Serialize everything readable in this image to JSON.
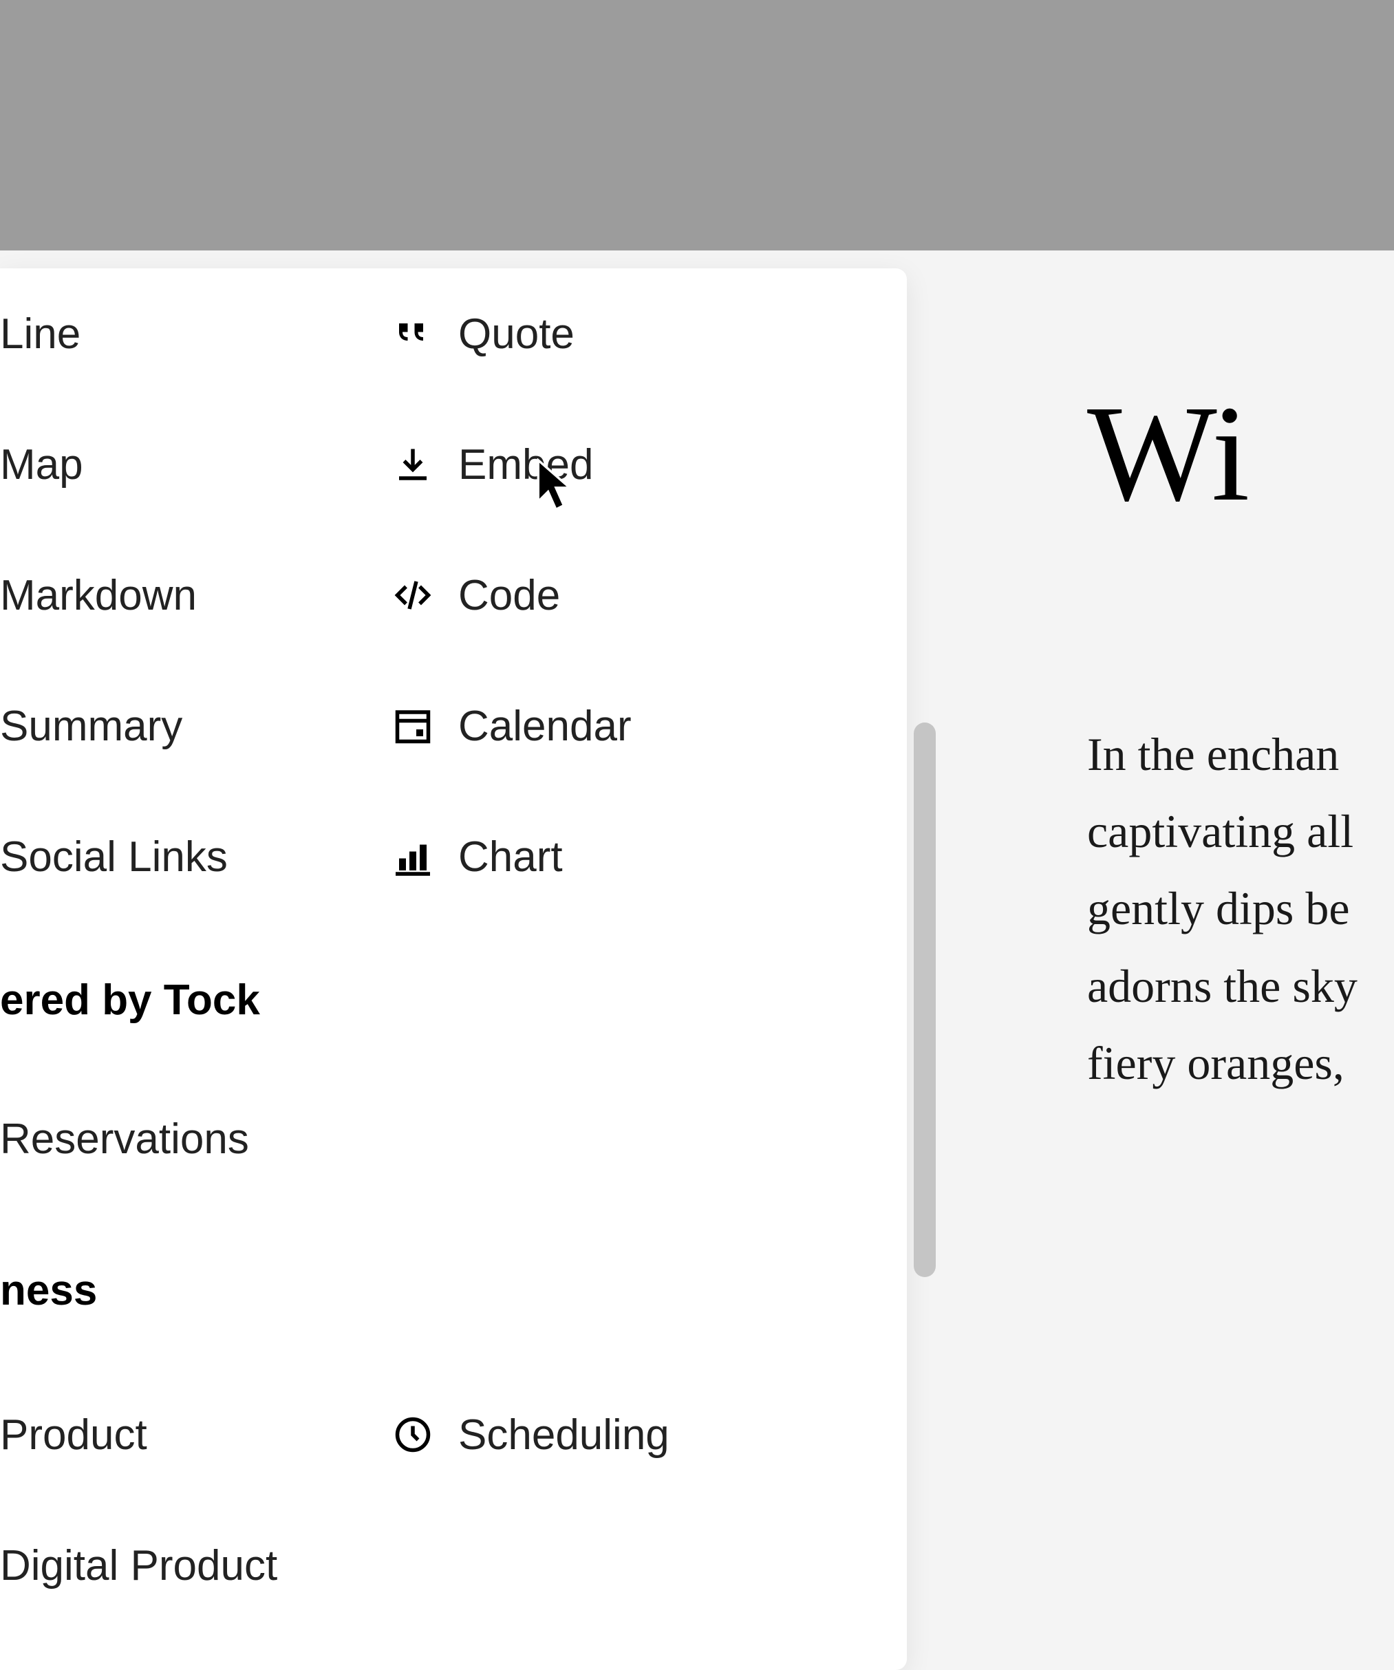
{
  "menu": {
    "left_items": [
      {
        "label": "Line"
      },
      {
        "label": "Map"
      },
      {
        "label": "Markdown"
      },
      {
        "label": "Summary"
      },
      {
        "label": "Social Links"
      }
    ],
    "right_items": [
      {
        "label": "Quote",
        "icon": "quote-icon"
      },
      {
        "label": "Embed",
        "icon": "download-icon"
      },
      {
        "label": "Code",
        "icon": "code-icon"
      },
      {
        "label": "Calendar",
        "icon": "calendar-icon"
      },
      {
        "label": "Chart",
        "icon": "chart-icon"
      }
    ],
    "section_tock": {
      "heading": "ered by Tock",
      "items": [
        {
          "label": "Reservations"
        }
      ]
    },
    "section_business": {
      "heading": "ness",
      "left_items": [
        {
          "label": "Product"
        },
        {
          "label": "Digital Product"
        }
      ],
      "right_items": [
        {
          "label": "Scheduling",
          "icon": "clock-icon"
        }
      ]
    }
  },
  "article": {
    "title": "Wi",
    "body_lines": [
      "In the enchan",
      "captivating all",
      "gently dips be",
      "adorns the sky",
      "fiery oranges,"
    ]
  }
}
